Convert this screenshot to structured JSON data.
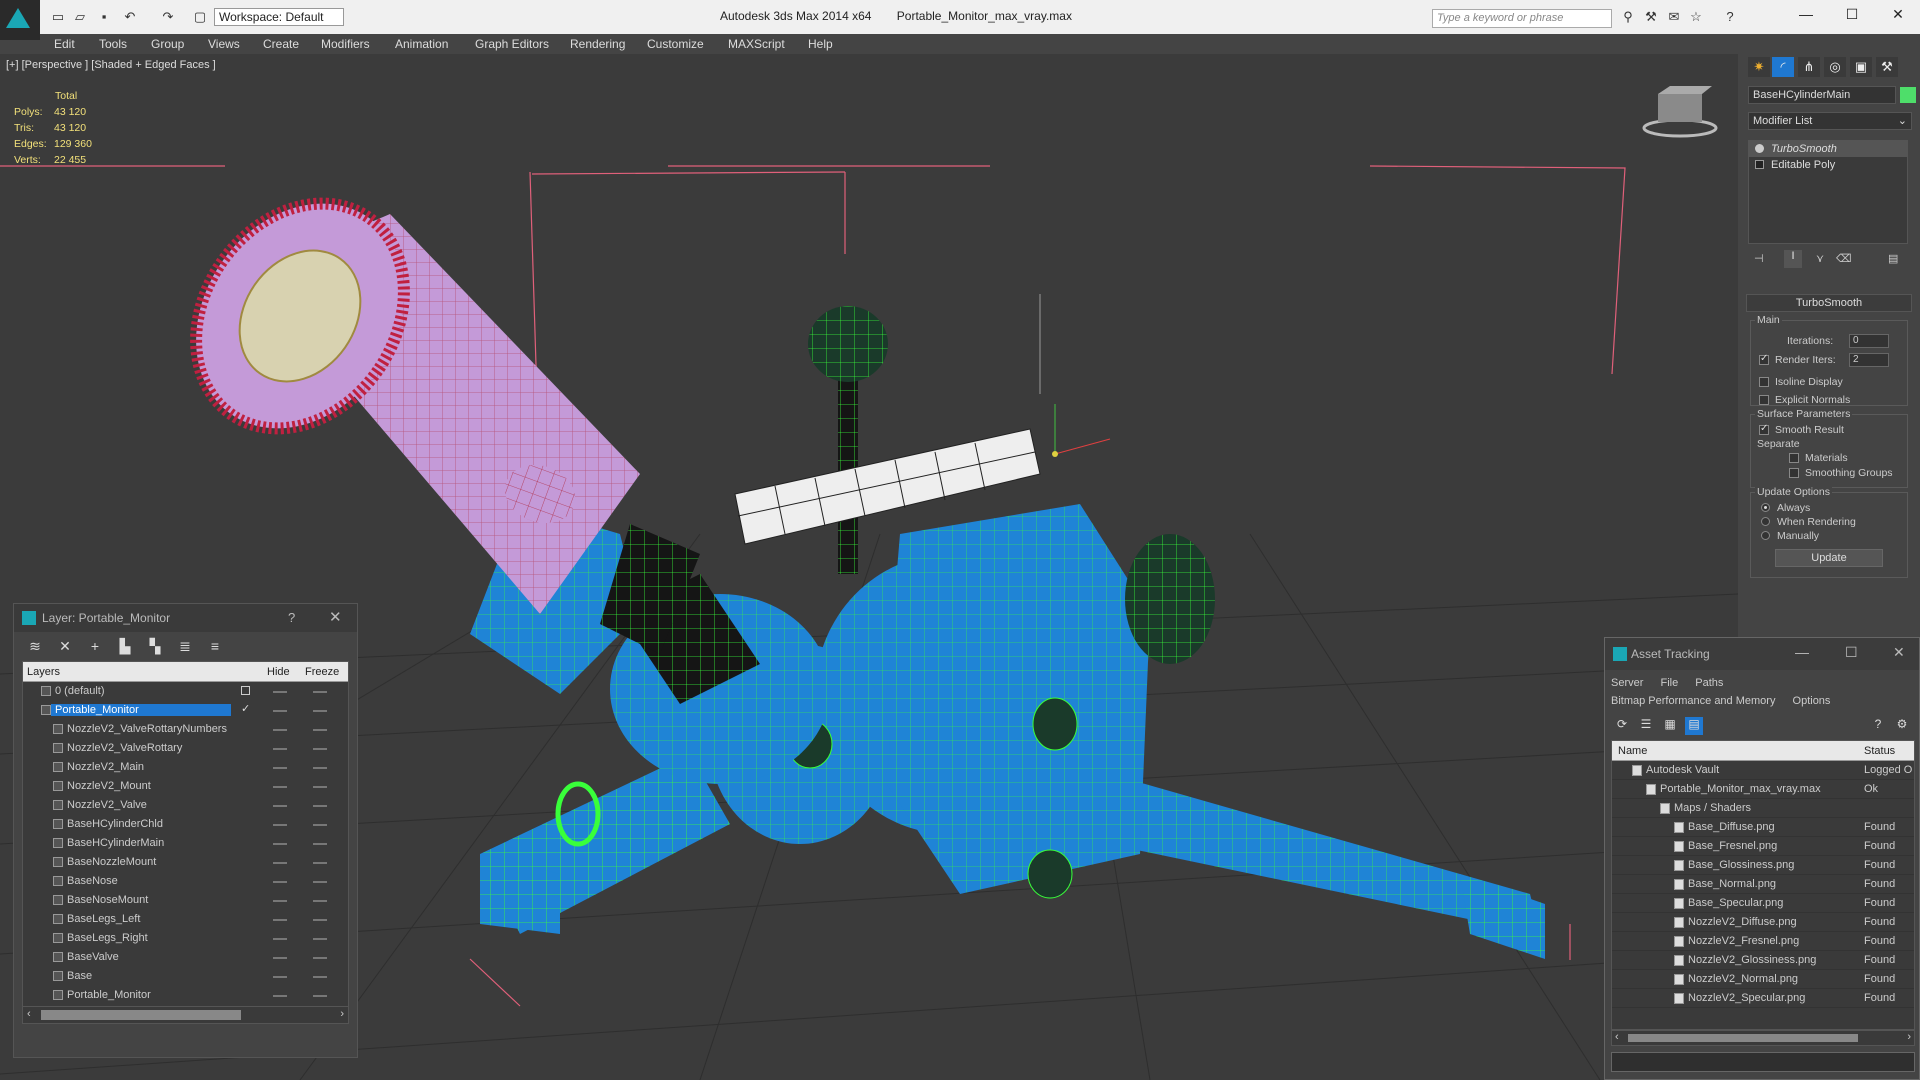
{
  "window": {
    "app_title": "Autodesk 3ds Max  2014 x64",
    "file_title": "Portable_Monitor_max_vray.max",
    "workspace": "Workspace: Default",
    "search_placeholder": "Type a keyword or phrase"
  },
  "menu": [
    "Edit",
    "Tools",
    "Group",
    "Views",
    "Create",
    "Modifiers",
    "Animation",
    "Graph Editors",
    "Rendering",
    "Customize",
    "MAXScript",
    "Help"
  ],
  "viewport": {
    "label": "[+] [Perspective ] [Shaded + Edged Faces ]",
    "stats": {
      "total_label": "Total",
      "rows": [
        {
          "label": "Polys:",
          "value": "43 120"
        },
        {
          "label": "Tris:",
          "value": "43 120"
        },
        {
          "label": "Edges:",
          "value": "129 360"
        },
        {
          "label": "Verts:",
          "value": "22 455"
        }
      ]
    }
  },
  "command_panel": {
    "object_name": "BaseHCylinderMain",
    "object_color": "#4ede6a",
    "modifier_list": "Modifier List",
    "stack": [
      "TurboSmooth",
      "Editable Poly"
    ],
    "rollout_title": "TurboSmooth",
    "main_label": "Main",
    "iterations_label": "Iterations:",
    "iterations_value": "0",
    "render_iters_label": "Render Iters:",
    "render_iters_value": "2",
    "isoline_label": "Isoline Display",
    "explicit_normals_label": "Explicit Normals",
    "surface_params_label": "Surface Parameters",
    "smooth_result_label": "Smooth Result",
    "separate_label": "Separate",
    "materials_label": "Materials",
    "smoothing_groups_label": "Smoothing Groups",
    "update_options_label": "Update Options",
    "always_label": "Always",
    "when_rendering_label": "When Rendering",
    "manually_label": "Manually",
    "update_button": "Update"
  },
  "layer_window": {
    "title": "Layer: Portable_Monitor",
    "help": "?",
    "col_layers": "Layers",
    "col_hide": "Hide",
    "col_freeze": "Freeze",
    "default_layer": "0 (default)",
    "selected_layer": "Portable_Monitor",
    "objects": [
      "NozzleV2_ValveRottaryNumbers",
      "NozzleV2_ValveRottary",
      "NozzleV2_Main",
      "NozzleV2_Mount",
      "NozzleV2_Valve",
      "BaseHCylinderChld",
      "BaseHCylinderMain",
      "BaseNozzleMount",
      "BaseNose",
      "BaseNoseMount",
      "BaseLegs_Left",
      "BaseLegs_Right",
      "BaseValve",
      "Base",
      "Portable_Monitor"
    ]
  },
  "asset_tracking": {
    "title": "Asset Tracking",
    "menu1": [
      "Server",
      "File",
      "Paths"
    ],
    "menu2": [
      "Bitmap Performance and Memory",
      "Options"
    ],
    "col_name": "Name",
    "col_status": "Status",
    "rows": [
      {
        "name": "Autodesk Vault",
        "status": "Logged O",
        "indent": 1
      },
      {
        "name": "Portable_Monitor_max_vray.max",
        "status": "Ok",
        "indent": 2
      },
      {
        "name": "Maps / Shaders",
        "status": "",
        "indent": 3
      },
      {
        "name": "Base_Diffuse.png",
        "status": "Found",
        "indent": 4
      },
      {
        "name": "Base_Fresnel.png",
        "status": "Found",
        "indent": 4
      },
      {
        "name": "Base_Glossiness.png",
        "status": "Found",
        "indent": 4
      },
      {
        "name": "Base_Normal.png",
        "status": "Found",
        "indent": 4
      },
      {
        "name": "Base_Specular.png",
        "status": "Found",
        "indent": 4
      },
      {
        "name": "NozzleV2_Diffuse.png",
        "status": "Found",
        "indent": 4
      },
      {
        "name": "NozzleV2_Fresnel.png",
        "status": "Found",
        "indent": 4
      },
      {
        "name": "NozzleV2_Glossiness.png",
        "status": "Found",
        "indent": 4
      },
      {
        "name": "NozzleV2_Normal.png",
        "status": "Found",
        "indent": 4
      },
      {
        "name": "NozzleV2_Specular.png",
        "status": "Found",
        "indent": 4
      }
    ]
  }
}
